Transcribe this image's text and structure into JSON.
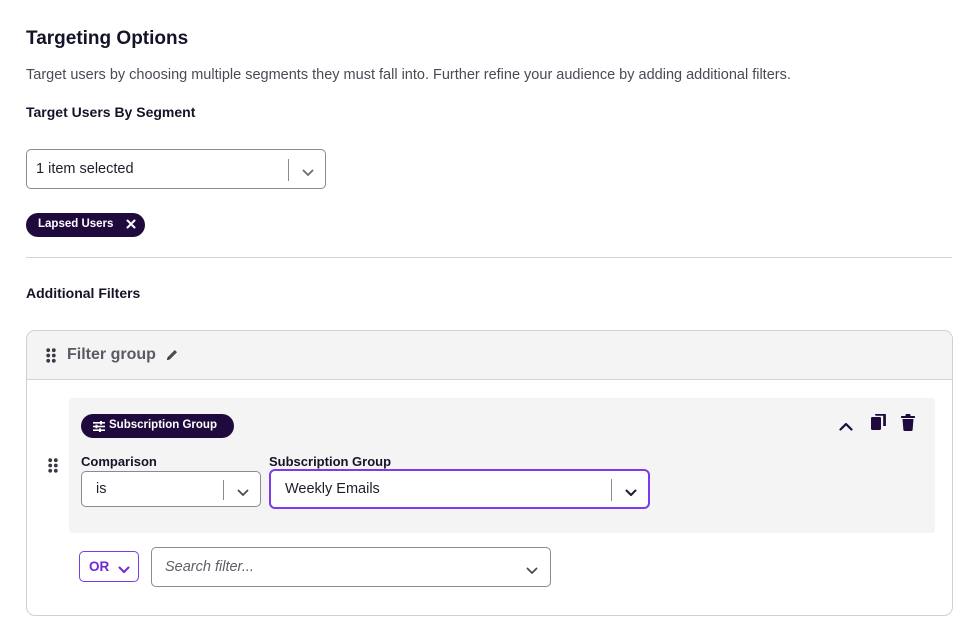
{
  "targeting": {
    "title": "Targeting Options",
    "description": "Target users by choosing multiple segments they must fall into. Further refine your audience by adding additional filters.",
    "segment_label": "Target Users By Segment",
    "segment_select_value": "1 item selected",
    "selected_segments": [
      {
        "label": "Lapsed Users"
      }
    ]
  },
  "additional_filters": {
    "label": "Additional Filters",
    "filter_group": {
      "name": "Filter group",
      "filter": {
        "type_badge": "Subscription Group",
        "comparison_label": "Comparison",
        "comparison_value": "is",
        "subscription_group_label": "Subscription Group",
        "subscription_group_value": "Weekly Emails"
      },
      "combinator": "OR",
      "search_placeholder": "Search filter..."
    }
  },
  "colors": {
    "tag_bg": "#1f0a3d",
    "accent": "#7c3aed"
  },
  "icons": {
    "drag_handle": "grip-vertical-icon",
    "edit": "pencil-icon",
    "remove": "close-icon",
    "filter_type": "sliders-icon",
    "collapse": "chevron-up-icon",
    "duplicate": "copy-icon",
    "delete": "trash-icon",
    "dropdown": "chevron-down-icon"
  }
}
